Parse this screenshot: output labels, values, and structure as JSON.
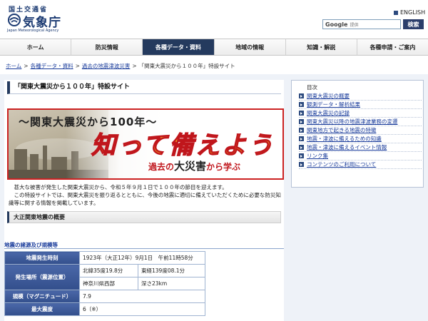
{
  "header": {
    "ministry": "国土交通省",
    "agency": "気象庁",
    "agency_en": "Japan Meteorological Agency",
    "english_link": "ENGLISH",
    "search_logo": "Google",
    "search_provider": "提供",
    "search_button": "検索"
  },
  "nav": {
    "items": [
      {
        "label": "ホーム",
        "active": false
      },
      {
        "label": "防災情報",
        "active": false
      },
      {
        "label": "各種データ・資料",
        "active": true
      },
      {
        "label": "地域の情報",
        "active": false
      },
      {
        "label": "知識・解説",
        "active": false
      },
      {
        "label": "各種申請・ご案内",
        "active": false
      }
    ]
  },
  "breadcrumb": {
    "items": [
      "ホーム",
      "各種データ・資料",
      "過去の地震津波災害",
      "「関東大震災から１００年」特設サイト"
    ],
    "separator": ">"
  },
  "main": {
    "page_title": "「関東大震災から１００年」特設サイト",
    "banner": {
      "title": "～関東大震災から100年～",
      "slogan": "知って備えよう",
      "sub_pre": "過去の",
      "sub_big": "大災害",
      "sub_post": "から学ぶ"
    },
    "intro": [
      "　甚大な被害が発生した関東大震災から、令和５年９月１日で１００年の節目を迎えます。",
      "　この特設サイトでは、関東大震災を振り返るとともに、今後の地震に適切に備えていただくために必要な防災知識等に関する情報を掲載しています。"
    ],
    "section_heading": "大正関東地震の概要",
    "sub_heading": "地震の諸源及び規模等",
    "table": {
      "rows": [
        {
          "label": "地震発生時刻",
          "values": [
            "1923年（大正12年）9月1日　午前11時58分"
          ]
        },
        {
          "label": "発生場所（震源位置）",
          "values": [
            "北緯35度19.8分",
            "東経139度08.1分"
          ]
        },
        {
          "label": "",
          "values": [
            "神奈川県西部",
            "深さ23km"
          ]
        },
        {
          "label": "規模（マグニチュード）",
          "values": [
            "7.9"
          ]
        },
        {
          "label": "最大震度",
          "values": [
            "6（※）"
          ]
        }
      ]
    }
  },
  "sidebar": {
    "title": "目次",
    "items": [
      "関東大震災の概要",
      "観測データ・解析結果",
      "関東大震災の記録",
      "関東大震災以降の地震津波業務の変遷",
      "関東地方で起きる地震の特徴",
      "地震・津波に備えるための知識",
      "地震・津波に備えるイベント情報",
      "リンク集",
      "コンテンツのご利用について"
    ]
  },
  "colors": {
    "nav_active": "#243a5e",
    "link": "#1a3c9b",
    "banner_border": "#cc2222",
    "slogan_fill": "#f0a01e",
    "slogan_stroke": "#c0161c",
    "table_header": "#3b5998",
    "main_background": "#eef2f8"
  }
}
